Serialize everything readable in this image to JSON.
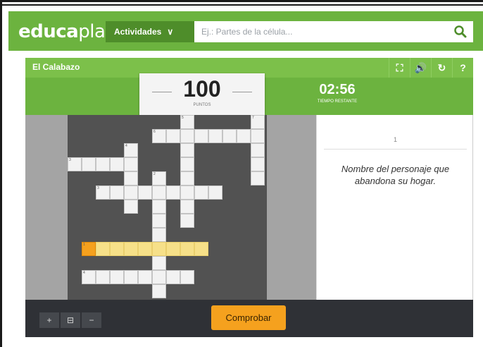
{
  "header": {
    "logo_bold": "educa",
    "logo_light": "play",
    "activities_label": "Actividades",
    "search_placeholder": "Ej.: Partes de la célula...",
    "brand_color": "#6cb33f"
  },
  "game": {
    "title": "El Calabazo",
    "toolbar_icons": [
      "fullscreen-icon",
      "sound-icon",
      "restart-icon",
      "help-icon"
    ],
    "score": {
      "value": "100",
      "label": "PUNTOS"
    },
    "timer": {
      "value": "02:56",
      "label": "TIEMPO RESTANTE"
    },
    "clue": {
      "number": "1",
      "text": "Nombre del personaje que abandona su hogar."
    },
    "crossword": {
      "clue_numbers": [
        "5",
        "7",
        "6",
        "4",
        "3",
        "2",
        "3",
        "1",
        "4"
      ]
    },
    "controls": {
      "zoom_in": "+",
      "zoom_fit": "⊟",
      "zoom_out": "−",
      "check_label": "Comprobar"
    }
  }
}
